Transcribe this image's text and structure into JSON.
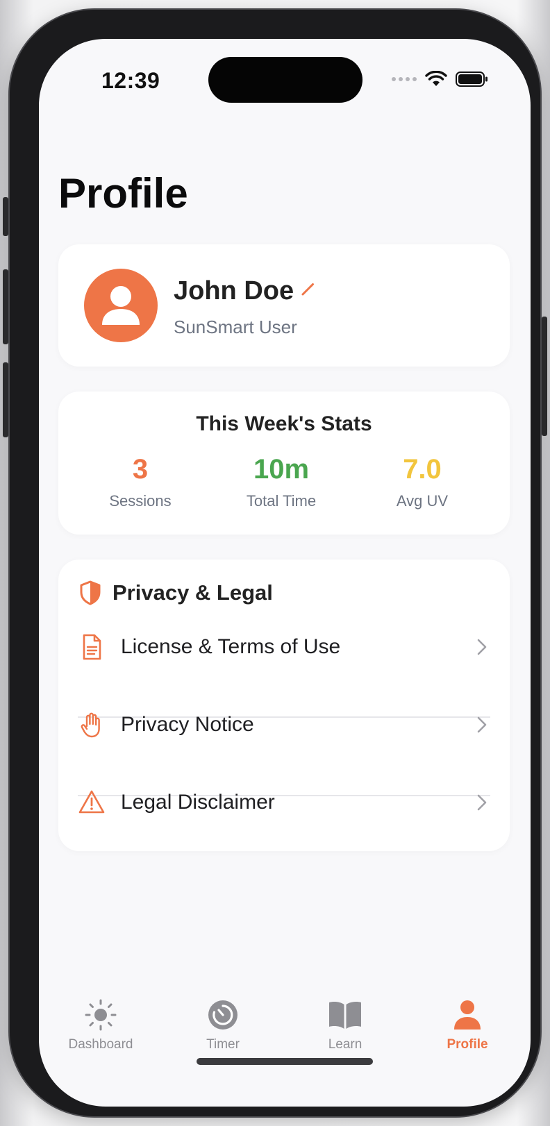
{
  "status_bar": {
    "time": "12:39"
  },
  "header": {
    "title": "Profile"
  },
  "profile": {
    "name": "John Doe",
    "role": "SunSmart User",
    "avatar_icon": "person-icon",
    "edit_icon": "pencil-icon"
  },
  "stats": {
    "title": "This Week's Stats",
    "items": [
      {
        "value": "3",
        "label": "Sessions",
        "color": "#ee7547"
      },
      {
        "value": "10m",
        "label": "Total Time",
        "color": "#4aa64f"
      },
      {
        "value": "7.0",
        "label": "Avg UV",
        "color": "#f2c53d"
      }
    ]
  },
  "privacy": {
    "title": "Privacy & Legal",
    "icon": "shield-icon",
    "items": [
      {
        "label": "License & Terms of Use",
        "icon": "document-icon"
      },
      {
        "label": "Privacy Notice",
        "icon": "hand-icon"
      },
      {
        "label": "Legal Disclaimer",
        "icon": "warning-icon"
      }
    ]
  },
  "tabbar": {
    "items": [
      {
        "label": "Dashboard",
        "icon": "sun-icon",
        "active": false
      },
      {
        "label": "Timer",
        "icon": "timer-icon",
        "active": false
      },
      {
        "label": "Learn",
        "icon": "book-icon",
        "active": false
      },
      {
        "label": "Profile",
        "icon": "person-icon",
        "active": true
      }
    ]
  },
  "colors": {
    "accent": "#ee7547",
    "green": "#4aa64f",
    "yellow": "#f2c53d",
    "inactive": "#8e8e93"
  }
}
